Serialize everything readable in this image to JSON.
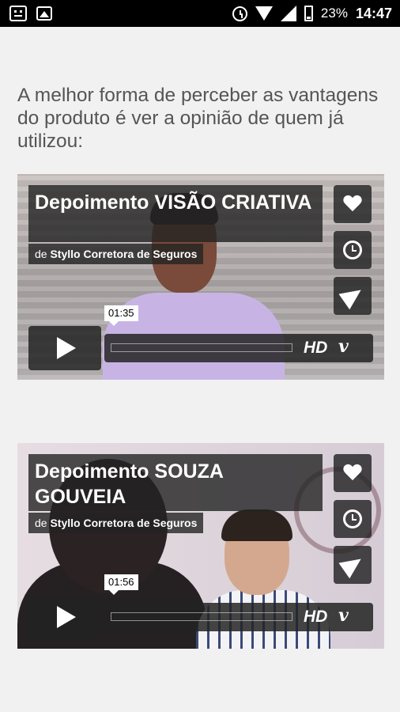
{
  "status_bar": {
    "battery": "23%",
    "time": "14:47"
  },
  "intro_text": "A melhor forma de perceber as vantagens do produto é ver a opinião de quem já utilizou:",
  "videos": [
    {
      "title": "Depoimento VISÃO CRIATIVA",
      "by_prefix": "de",
      "author": "Styllo Corretora de Seguros",
      "duration": "01:35",
      "hd_label": "HD"
    },
    {
      "title": "Depoimento SOUZA GOUVEIA",
      "by_prefix": "de",
      "author": "Styllo Corretora de Seguros",
      "duration": "01:56",
      "hd_label": "HD"
    }
  ],
  "icons": {
    "like": "heart-icon",
    "watch_later": "clock-icon",
    "share": "paper-plane-icon",
    "play": "play-icon",
    "vimeo": "vimeo-logo"
  },
  "vimeo_glyph": "v"
}
